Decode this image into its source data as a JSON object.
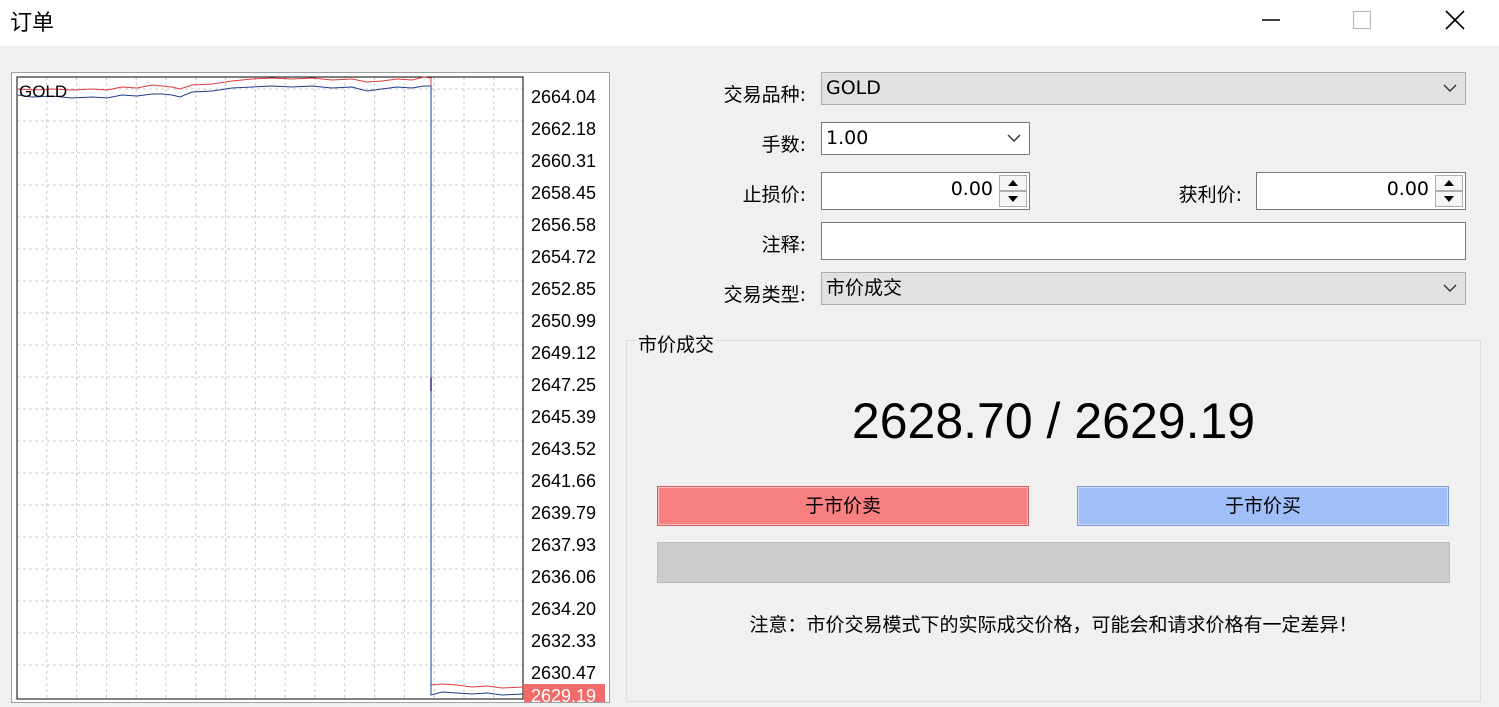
{
  "window": {
    "title": "订单"
  },
  "chart": {
    "symbol": "GOLD",
    "price_labels": [
      "2664.04",
      "2662.18",
      "2660.31",
      "2658.45",
      "2656.58",
      "2654.72",
      "2652.85",
      "2650.99",
      "2649.12",
      "2647.25",
      "2645.39",
      "2643.52",
      "2641.66",
      "2639.79",
      "2637.93",
      "2636.06",
      "2634.20",
      "2632.33",
      "2630.47"
    ],
    "current_price": "2629.19",
    "colors": {
      "ask_line": "#e03c3c",
      "bid_line": "#1e3c8c",
      "current_tag": "#f26a6a",
      "grid": "#c8c8c8"
    }
  },
  "form": {
    "symbol_label": "交易品种:",
    "symbol_value": "GOLD",
    "volume_label": "手数:",
    "volume_value": "1.00",
    "sl_label": "止损价:",
    "sl_value": "0.00",
    "tp_label": "获利价:",
    "tp_value": "0.00",
    "comment_label": "注释:",
    "comment_value": "",
    "type_label": "交易类型:",
    "type_value": "市价成交"
  },
  "market": {
    "group_title": "市价成交",
    "quote": "2628.70 / 2629.19",
    "sell_label": "于市价卖",
    "buy_label": "于市价买",
    "note": "注意：市价交易模式下的实际成交价格，可能会和请求价格有一定差异！",
    "colors": {
      "sell": "#f88080",
      "buy": "#a0bff8"
    }
  }
}
